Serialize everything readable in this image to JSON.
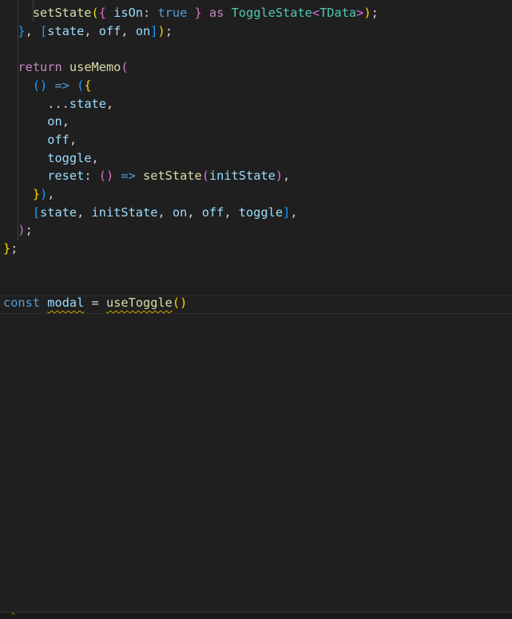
{
  "colors": {
    "text": "#d4d4d4",
    "keyword": "#569cd6",
    "control": "#c586c0",
    "func": "#dcdcaa",
    "var": "#9cdcfe",
    "type": "#4ec9b0",
    "b1": "#ffd700",
    "b2": "#da70d6",
    "b3": "#179fff"
  },
  "lines": [
    [
      [
        "    ",
        "text"
      ],
      [
        "setState",
        "func"
      ],
      [
        "(",
        "b1"
      ],
      [
        "{ ",
        "b2"
      ],
      [
        "isOn",
        "var"
      ],
      [
        ": ",
        "text"
      ],
      [
        "true",
        "keyword"
      ],
      [
        " }",
        "b2"
      ],
      [
        " ",
        "text"
      ],
      [
        "as",
        "control"
      ],
      [
        " ",
        "text"
      ],
      [
        "ToggleState",
        "type"
      ],
      [
        "<",
        "b2"
      ],
      [
        "TData",
        "type"
      ],
      [
        ">",
        "b2"
      ],
      [
        ")",
        "b1"
      ],
      [
        ";",
        "text"
      ]
    ],
    [
      [
        "  ",
        "text"
      ],
      [
        "}",
        "b3"
      ],
      [
        ", ",
        "text"
      ],
      [
        "[",
        "b3"
      ],
      [
        "state",
        "var"
      ],
      [
        ", ",
        "text"
      ],
      [
        "off",
        "var"
      ],
      [
        ", ",
        "text"
      ],
      [
        "on",
        "var"
      ],
      [
        "]",
        "b3"
      ],
      [
        ")",
        "b1"
      ],
      [
        ";",
        "text"
      ]
    ],
    [],
    [
      [
        "  ",
        "text"
      ],
      [
        "return",
        "control"
      ],
      [
        " ",
        "text"
      ],
      [
        "useMemo",
        "func"
      ],
      [
        "(",
        "b2"
      ]
    ],
    [
      [
        "    ",
        "text"
      ],
      [
        "()",
        "b3"
      ],
      [
        " ",
        "text"
      ],
      [
        "=>",
        "keyword"
      ],
      [
        " ",
        "text"
      ],
      [
        "(",
        "b3"
      ],
      [
        "{",
        "b1"
      ]
    ],
    [
      [
        "      ",
        "text"
      ],
      [
        "...",
        "text"
      ],
      [
        "state",
        "var"
      ],
      [
        ",",
        "text"
      ]
    ],
    [
      [
        "      ",
        "text"
      ],
      [
        "on",
        "var"
      ],
      [
        ",",
        "text"
      ]
    ],
    [
      [
        "      ",
        "text"
      ],
      [
        "off",
        "var"
      ],
      [
        ",",
        "text"
      ]
    ],
    [
      [
        "      ",
        "text"
      ],
      [
        "toggle",
        "var"
      ],
      [
        ",",
        "text"
      ]
    ],
    [
      [
        "      ",
        "text"
      ],
      [
        "reset",
        "var"
      ],
      [
        ": ",
        "text"
      ],
      [
        "()",
        "b2"
      ],
      [
        " ",
        "text"
      ],
      [
        "=>",
        "keyword"
      ],
      [
        " ",
        "text"
      ],
      [
        "setState",
        "func"
      ],
      [
        "(",
        "b2"
      ],
      [
        "initState",
        "var"
      ],
      [
        ")",
        "b2"
      ],
      [
        ",",
        "text"
      ]
    ],
    [
      [
        "    ",
        "text"
      ],
      [
        "}",
        "b1"
      ],
      [
        ")",
        "b3"
      ],
      [
        ",",
        "text"
      ]
    ],
    [
      [
        "    ",
        "text"
      ],
      [
        "[",
        "b3"
      ],
      [
        "state",
        "var"
      ],
      [
        ", ",
        "text"
      ],
      [
        "initState",
        "var"
      ],
      [
        ", ",
        "text"
      ],
      [
        "on",
        "var"
      ],
      [
        ", ",
        "text"
      ],
      [
        "off",
        "var"
      ],
      [
        ", ",
        "text"
      ],
      [
        "toggle",
        "var"
      ],
      [
        "]",
        "b3"
      ],
      [
        ",",
        "text"
      ]
    ],
    [
      [
        "  ",
        "text"
      ],
      [
        ")",
        "b2"
      ],
      [
        ";",
        "text"
      ]
    ],
    [
      [
        "}",
        "b1"
      ],
      [
        ";",
        "text"
      ]
    ],
    [],
    [],
    [
      [
        "const",
        "keyword"
      ],
      [
        " ",
        "text"
      ],
      [
        "modal",
        "var",
        "squig"
      ],
      [
        " = ",
        "text"
      ],
      [
        "useToggle",
        "func",
        "squig"
      ],
      [
        "()",
        "b1"
      ]
    ]
  ],
  "status": {
    "warning_icon": "warning-icon",
    "warning_glyph": "^"
  }
}
